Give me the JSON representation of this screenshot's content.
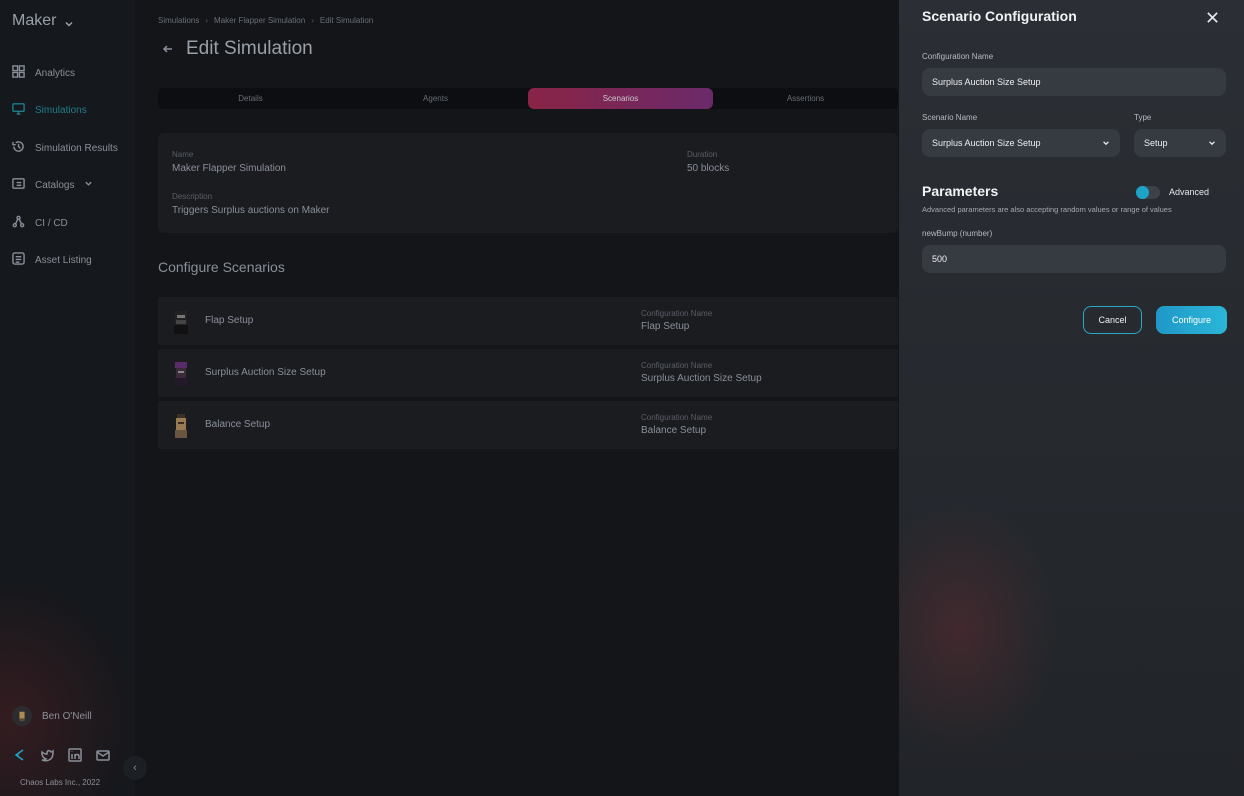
{
  "sidebar": {
    "brand": "Maker",
    "items": [
      {
        "label": "Analytics",
        "icon": "analytics-icon",
        "active": false
      },
      {
        "label": "Simulations",
        "icon": "monitor-icon",
        "active": true
      },
      {
        "label": "Simulation Results",
        "icon": "history-icon",
        "active": false
      },
      {
        "label": "Catalogs",
        "icon": "catalog-icon",
        "active": false
      },
      {
        "label": "CI / CD",
        "icon": "cicd-icon",
        "active": false
      },
      {
        "label": "Asset Listing",
        "icon": "asset-icon",
        "active": false
      }
    ],
    "user": "Ben O'Neill",
    "footer": "Chaos Labs Inc., 2022"
  },
  "main": {
    "breadcrumb": [
      "Simulations",
      "Maker Flapper Simulation",
      "Edit Simulation"
    ],
    "title": "Edit Simulation",
    "tabs": [
      "Details",
      "Agents",
      "Scenarios",
      "Assertions"
    ],
    "active_tab": "Scenarios",
    "details": {
      "name_label": "Name",
      "name_value": "Maker Flapper Simulation",
      "duration_label": "Duration",
      "duration_value": "50 blocks",
      "description_label": "Description",
      "description_value": "Triggers Surplus auctions on Maker"
    },
    "section_title": "Configure Scenarios",
    "scenarios": [
      {
        "name": "Flap Setup",
        "config_label": "Configuration Name",
        "config_value": "Flap Setup"
      },
      {
        "name": "Surplus Auction Size Setup",
        "config_label": "Configuration Name",
        "config_value": "Surplus Auction Size Setup"
      },
      {
        "name": "Balance Setup",
        "config_label": "Configuration Name",
        "config_value": "Balance Setup"
      }
    ]
  },
  "drawer": {
    "title": "Scenario Configuration",
    "config_name_label": "Configuration Name",
    "config_name_value": "Surplus Auction Size Setup",
    "scenario_name_label": "Scenario Name",
    "scenario_name_value": "Surplus Auction Size Setup",
    "type_label": "Type",
    "type_value": "Setup",
    "params_title": "Parameters",
    "advanced_label": "Advanced",
    "advanced_on": false,
    "params_desc": "Advanced parameters are also accepting random values or range of values",
    "param_label": "newBump (number)",
    "param_value": "500",
    "cancel_label": "Cancel",
    "configure_label": "Configure"
  },
  "colors": {
    "accent": "#1ea3c8",
    "active_nav": "#1f7e8c",
    "tab_active_start": "#8a2446",
    "tab_active_end": "#6a2a6a"
  }
}
